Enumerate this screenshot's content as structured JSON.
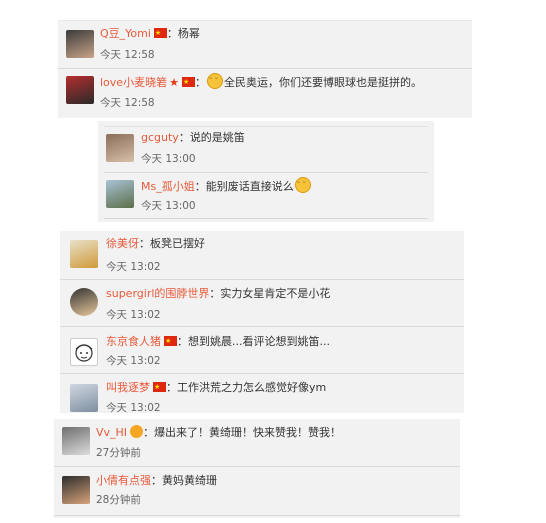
{
  "comments_top": [
    {
      "name": "Q豆_Yomi",
      "text": "杨幂",
      "time": "今天 12:58"
    },
    {
      "name": "love小麦晓箬",
      "text": "全民奥运，你们还要博眼球也是挺拼的。",
      "time": "今天 12:58"
    }
  ],
  "comments_nested": [
    {
      "name": "gcguty",
      "text": "说的是姚笛",
      "time": "今天 13:00"
    },
    {
      "name": "Ms_孤小姐",
      "text": "能别废话直接说么",
      "time": "今天 13:00"
    }
  ],
  "comments_mid": [
    {
      "name": "徐美伢",
      "text": "板凳已摆好",
      "time": "今天 13:02"
    },
    {
      "name": "supergirl的围脖世界",
      "text": "实力女星肯定不是小花",
      "time": "今天 13:02"
    },
    {
      "name": "东京食人猪",
      "text": "想到姚晨...看评论想到姚笛...",
      "time": "今天 13:02"
    },
    {
      "name": "叫我逐梦",
      "text": "工作洪荒之力怎么感觉好像ym",
      "time": "今天 13:02"
    }
  ],
  "comments_bottom": [
    {
      "name": "Vv_HI",
      "text": "爆出来了！黄绮珊！快来赞我！赞我！",
      "time": "27分钟前"
    },
    {
      "name": "小倩有点强",
      "text": "黄妈黄绮珊",
      "time": "28分钟前"
    }
  ]
}
